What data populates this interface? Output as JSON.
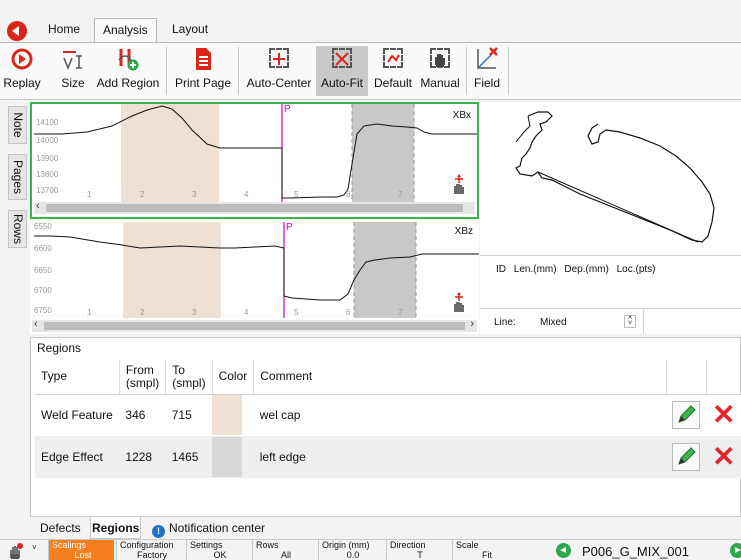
{
  "menu": {
    "tabs": [
      {
        "label": "Home"
      },
      {
        "label": "Analysis"
      },
      {
        "label": "Layout"
      }
    ]
  },
  "ribbon": {
    "replay": "Replay",
    "size": "Size",
    "add_region": "Add Region",
    "print_page": "Print Page",
    "auto_center": "Auto-Center",
    "auto_fit": "Auto-Fit",
    "default": "Default",
    "manual": "Manual",
    "field": "Field"
  },
  "side_tabs": {
    "note": "Note",
    "pages": "Pages",
    "rows": "Rows"
  },
  "plots": {
    "xbx": {
      "name": "XBx",
      "y_ticks": [
        "14100",
        "14000",
        "13900",
        "13800",
        "13700"
      ],
      "x_ticks": [
        "1",
        "2",
        "3",
        "4",
        "5",
        "6",
        "7"
      ],
      "cursor_label": "P"
    },
    "xbz": {
      "name": "XBz",
      "y_ticks": [
        "6550",
        "6600",
        "6650",
        "6700",
        "6750"
      ],
      "x_ticks": [
        "1",
        "2",
        "3",
        "4",
        "5",
        "6",
        "7"
      ],
      "cursor_label": "P"
    }
  },
  "right_panel": {
    "columns": [
      "ID",
      "Len.(mm)",
      "Dep.(mm)",
      "Loc.(pts)"
    ],
    "line_label": "Line:",
    "line_value": "Mixed"
  },
  "regions": {
    "title": "Regions",
    "headers": {
      "type": "Type",
      "from": "From (smpl)",
      "to": "To (smpl)",
      "color": "Color",
      "comment": "Comment"
    },
    "rows": [
      {
        "type": "Weld Feature",
        "from": "346",
        "to": "715",
        "color": "#eee0d3",
        "comment": "wel cap"
      },
      {
        "type": "Edge Effect",
        "from": "1228",
        "to": "1465",
        "color": "#d8d8d8",
        "comment": "left edge"
      }
    ]
  },
  "bottom_tabs": {
    "defects": "Defects",
    "regions": "Regions",
    "notification": "Notification center"
  },
  "status": {
    "scalings": {
      "label": "Scalings",
      "value": "Lost"
    },
    "configuration": {
      "label": "Configuration",
      "value": "Factory"
    },
    "settings": {
      "label": "Settings",
      "value": "OK"
    },
    "rows": {
      "label": "Rows",
      "value": "All"
    },
    "origin": {
      "label": "Origin (mm)",
      "value": "0.0"
    },
    "direction": {
      "label": "Direction",
      "value": "T"
    },
    "scale": {
      "label": "Scale",
      "value": "Fit"
    },
    "file": "P006_G_MIX_001"
  },
  "colors": {
    "accent_red": "#d9261c",
    "plot_active_border": "#3cb44b",
    "region_beige": "#eee0d3",
    "region_gray": "#c8c8c8",
    "cursor_magenta": "#d000d0",
    "status_warning": "#f57f1f",
    "nav_green": "#2ba84a"
  }
}
